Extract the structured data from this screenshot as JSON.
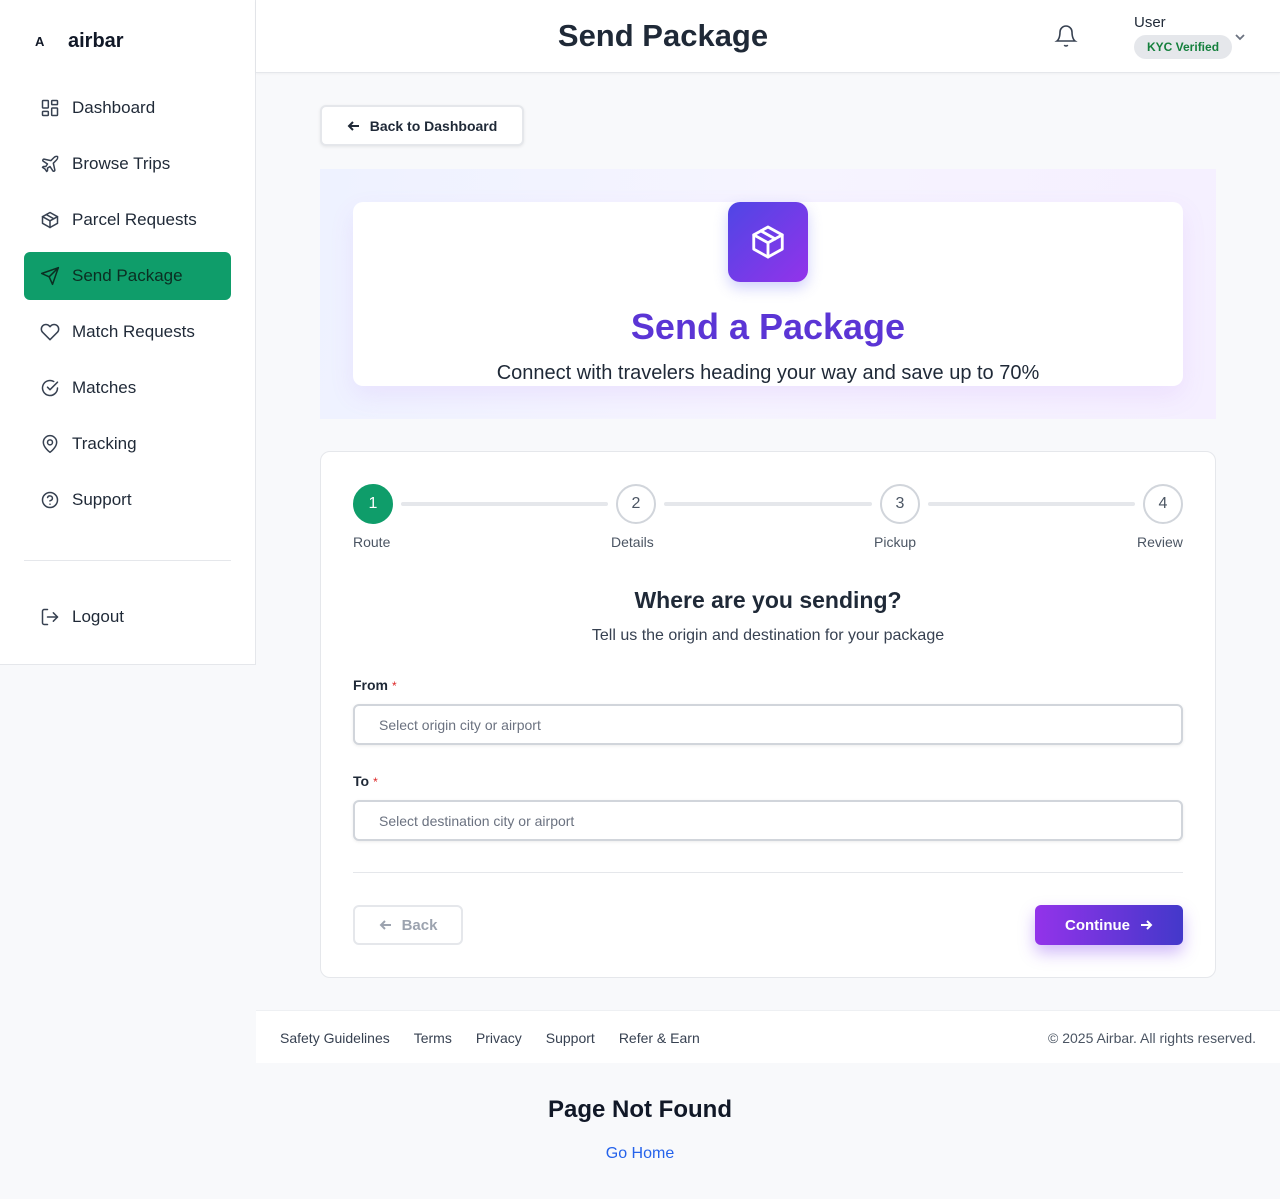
{
  "brand": {
    "mark": "A",
    "name": "airbar"
  },
  "sidebar": {
    "items": [
      {
        "label": "Dashboard",
        "icon": "dashboard-icon"
      },
      {
        "label": "Browse Trips",
        "icon": "plane-icon"
      },
      {
        "label": "Parcel Requests",
        "icon": "package-icon"
      },
      {
        "label": "Send Package",
        "icon": "send-icon",
        "active": true
      },
      {
        "label": "Match Requests",
        "icon": "heart-icon"
      },
      {
        "label": "Matches",
        "icon": "check-circle-icon"
      },
      {
        "label": "Tracking",
        "icon": "map-pin-icon"
      },
      {
        "label": "Support",
        "icon": "help-circle-icon"
      }
    ],
    "logout_label": "Logout"
  },
  "header": {
    "title": "Send Package",
    "user_name": "User",
    "kyc_badge": "KYC Verified"
  },
  "back_to_dashboard_label": "Back to Dashboard",
  "hero": {
    "title": "Send a Package",
    "subtitle": "Connect with travelers heading your way and save up to 70%"
  },
  "stepper": {
    "steps": [
      {
        "number": "1",
        "label": "Route",
        "active": true
      },
      {
        "number": "2",
        "label": "Details"
      },
      {
        "number": "3",
        "label": "Pickup"
      },
      {
        "number": "4",
        "label": "Review"
      }
    ]
  },
  "form": {
    "title": "Where are you sending?",
    "subtitle": "Tell us the origin and destination for your package",
    "from_label": "From",
    "from_placeholder": "Select origin city or airport",
    "to_label": "To",
    "to_placeholder": "Select destination city or airport",
    "required_marker": "*",
    "back_label": "Back",
    "continue_label": "Continue"
  },
  "footer": {
    "links": [
      "Safety Guidelines",
      "Terms",
      "Privacy",
      "Support",
      "Refer & Earn"
    ],
    "copyright": "© 2025 Airbar. All rights reserved."
  },
  "not_found": {
    "title": "Page Not Found",
    "link": "Go Home"
  },
  "colors": {
    "accent_green": "#0f9d6a",
    "brand_purple": "#5b35d5",
    "kyc_green": "#15803d",
    "link_blue": "#2563eb"
  }
}
